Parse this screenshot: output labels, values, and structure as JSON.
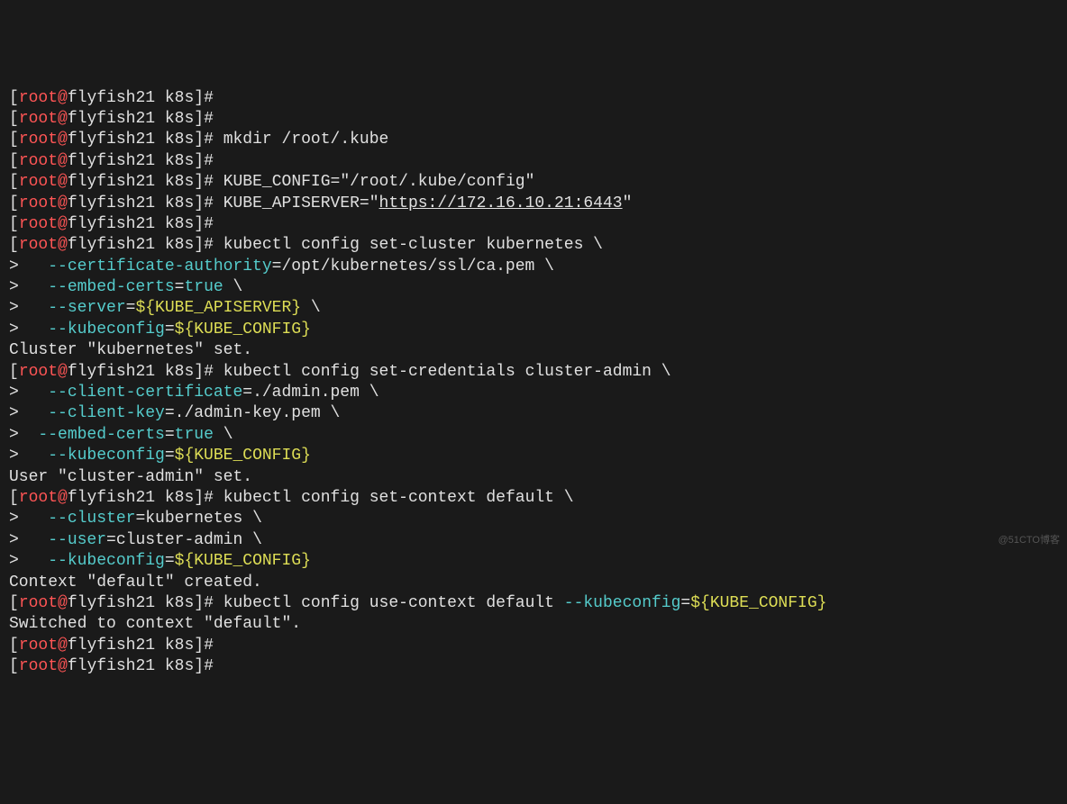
{
  "prompt": {
    "open": "[",
    "user": "root",
    "at": "@",
    "host": "flyfish21",
    "space": " ",
    "path": "k8s",
    "close": "]",
    "hash": "#"
  },
  "cont": ">",
  "cmds": {
    "blank": "",
    "mkdir": " mkdir /root/.kube",
    "kube_cfg": " KUBE_CONFIG=\"/root/.kube/config\"",
    "kube_api_pre": " KUBE_APISERVER=\"",
    "kube_api_url": "https://172.16.10.21:6443",
    "kube_api_post": "\"",
    "set_cluster": " kubectl config set-cluster kubernetes \\",
    "set_creds": " kubectl config set-credentials cluster-admin \\",
    "set_ctx": " kubectl config set-context default \\",
    "use_ctx_pre": " kubectl config use-context default ",
    "use_ctx_flag": "--kubeconfig",
    "use_ctx_eq": "="
  },
  "args": {
    "ca_flag": "--certificate-authority",
    "ca_val": "/opt/kubernetes/ssl/ca.pem \\",
    "embed_flag": "--embed-certs",
    "embed_val": "true",
    "embed_tail": " \\",
    "server_flag": "--server",
    "server_var": "${KUBE_APISERVER}",
    "server_tail": " \\",
    "kubeconfig_flag": "--kubeconfig",
    "kubeconfig_var": "${KUBE_CONFIG}",
    "cc_flag": "--client-certificate",
    "cc_val": "./admin.pem \\",
    "ck_flag": "--client-key",
    "ck_val": "./admin-key.pem \\",
    "cluster_flag": "--cluster",
    "cluster_val": "kubernetes \\",
    "user_flag": "--user",
    "user_val": "cluster-admin \\"
  },
  "out": {
    "cluster_set": "Cluster \"kubernetes\" set.",
    "user_set": "User \"cluster-admin\" set.",
    "ctx_created": "Context \"default\" created.",
    "switched": "Switched to context \"default\"."
  },
  "spaces": {
    "ind": "   ",
    "ind2": "  "
  },
  "watermark": "@51CTO博客"
}
